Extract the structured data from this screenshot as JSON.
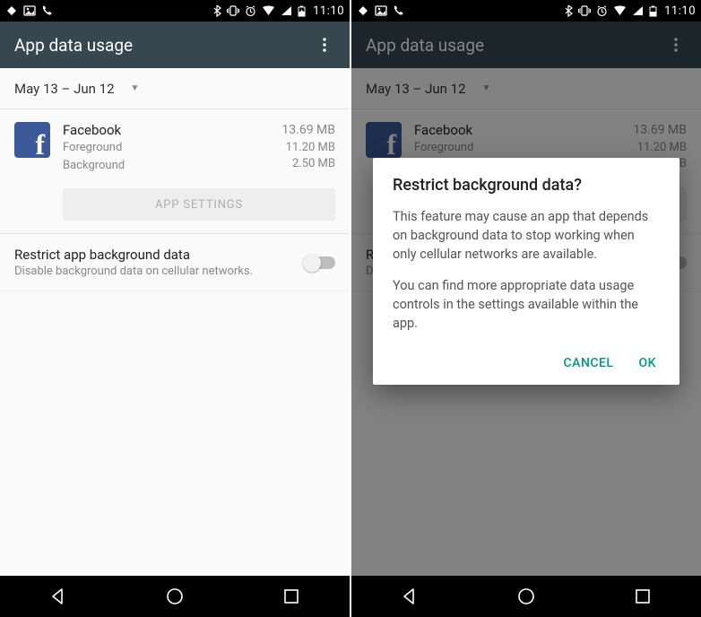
{
  "status": {
    "time": "11:10"
  },
  "appbar": {
    "title": "App data usage"
  },
  "daterange": {
    "label": "May 13 – Jun 12"
  },
  "app": {
    "name": "Facebook",
    "fg_label": "Foreground",
    "bg_label": "Background",
    "total": "13.69 MB",
    "fg": "11.20 MB",
    "bg": "2.50 MB",
    "settings_btn": "APP SETTINGS"
  },
  "restrict": {
    "title": "Restrict app background data",
    "sub": "Disable background data on cellular networks."
  },
  "dialog": {
    "title": "Restrict background data?",
    "p1": "This feature may cause an app that depends on background data to stop working when only cellular networks are available.",
    "p2": "You can find more appropriate data usage controls in the settings available within the app.",
    "cancel": "CANCEL",
    "ok": "OK"
  }
}
